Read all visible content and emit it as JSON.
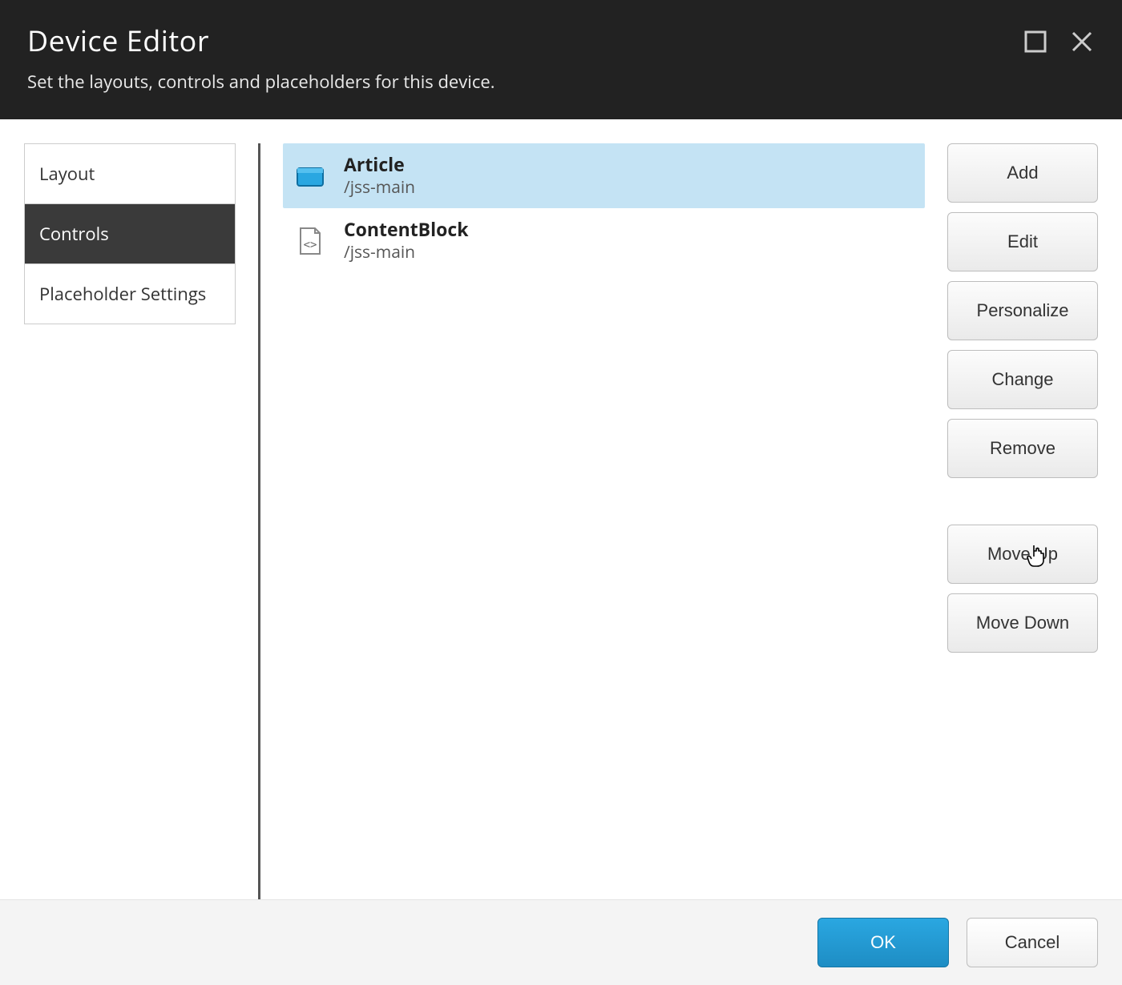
{
  "header": {
    "title": "Device Editor",
    "subtitle": "Set the layouts, controls and placeholders for this device."
  },
  "tabs": [
    {
      "label": "Layout",
      "active": false
    },
    {
      "label": "Controls",
      "active": true
    },
    {
      "label": "Placeholder Settings",
      "active": false
    }
  ],
  "items": [
    {
      "title": "Article",
      "placeholder": "/jss-main",
      "selected": true,
      "iconType": "folder"
    },
    {
      "title": "ContentBlock",
      "placeholder": "/jss-main",
      "selected": false,
      "iconType": "code-file"
    }
  ],
  "actions": {
    "add": "Add",
    "edit": "Edit",
    "personalize": "Personalize",
    "change": "Change",
    "remove": "Remove",
    "moveUp": "Move Up",
    "moveDown": "Move Down"
  },
  "footer": {
    "ok": "OK",
    "cancel": "Cancel"
  }
}
